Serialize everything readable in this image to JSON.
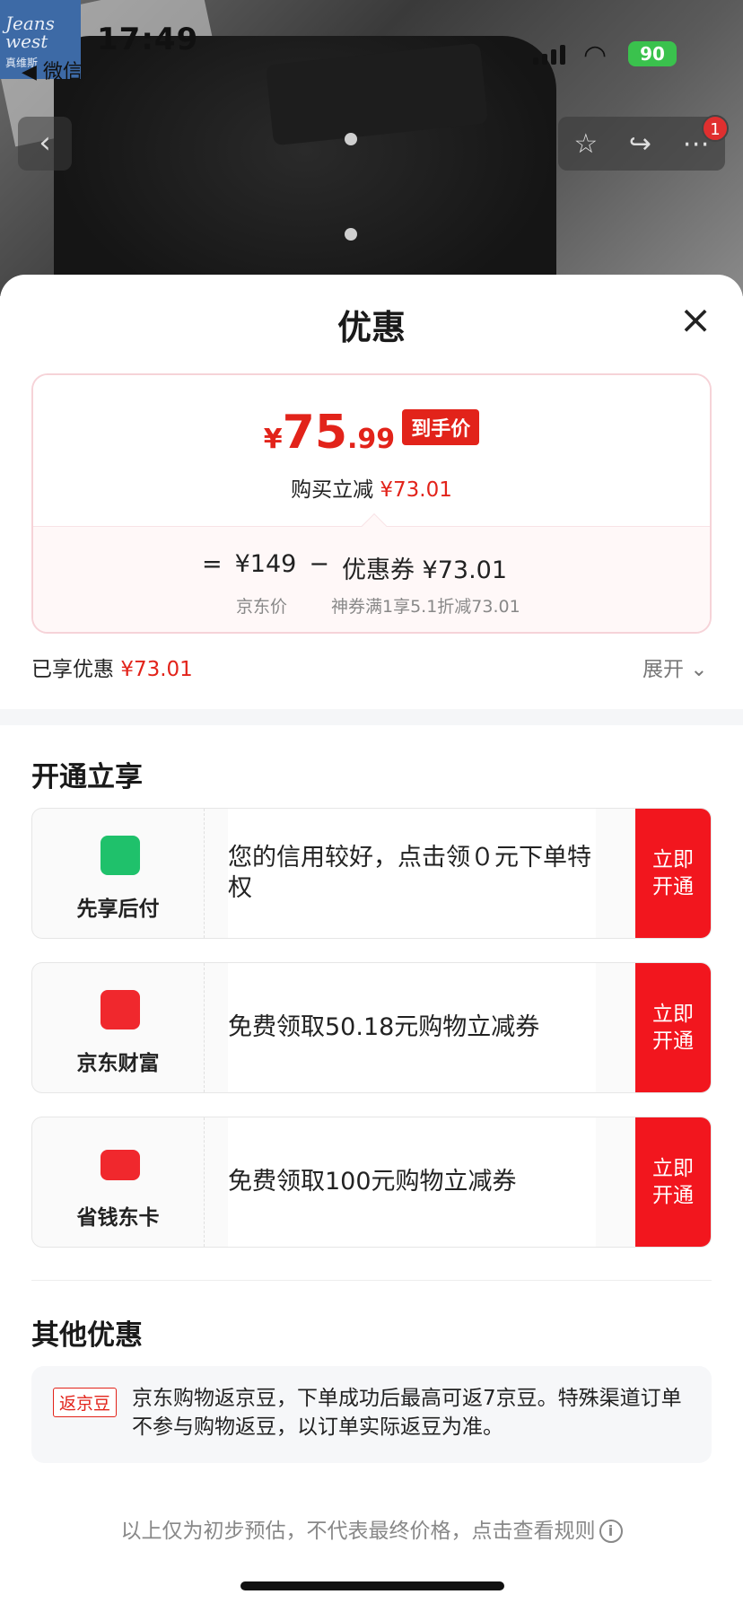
{
  "status": {
    "time": "17:49",
    "back_app": "◀ 微信",
    "battery": "90"
  },
  "logo": {
    "line1": "Jeans",
    "line2": "west",
    "sub": "真维斯"
  },
  "nav": {
    "back_icon": "chevron-left-icon",
    "badge": "1"
  },
  "sheet": {
    "title": "优惠",
    "close_icon": "close-icon"
  },
  "price": {
    "yen": "¥",
    "int": "75",
    "dec": ".99",
    "tag": "到手价",
    "save_label": "购买立减",
    "save_value": "¥73.01"
  },
  "formula": {
    "eq": "=",
    "base": "¥149",
    "minus": "−",
    "coupon": "优惠券 ¥73.01",
    "base_sub": "京东价",
    "coupon_sub": "神券满1享5.1折减73.01"
  },
  "enjoyed": {
    "label": "已享优惠",
    "value": "¥73.01",
    "expand": "展开 ⌄"
  },
  "open_section": {
    "title": "开通立享",
    "offers": [
      {
        "name": "先享后付",
        "desc": "您的信用较好，点击领０元下单特权",
        "btn": "立即开通",
        "color": "#1fc16b"
      },
      {
        "name": "京东财富",
        "desc": "免费领取50.18元购物立减券",
        "btn": "立即开通",
        "color": "#f0282d"
      },
      {
        "name": "省钱东卡",
        "desc": "免费领取100元购物立减券",
        "btn": "立即开通",
        "color": "#f0282d"
      }
    ]
  },
  "other_section": {
    "title": "其他优惠",
    "tag": "返京豆",
    "text": "京东购物返京豆，下单成功后最高可返7京豆。特殊渠道订单不参与购物返豆，以订单实际返豆为准。"
  },
  "footnote": "以上仅为初步预估，不代表最终价格，点击查看规则",
  "colors": {
    "accent": "#e2231a",
    "button": "#f2161e"
  }
}
